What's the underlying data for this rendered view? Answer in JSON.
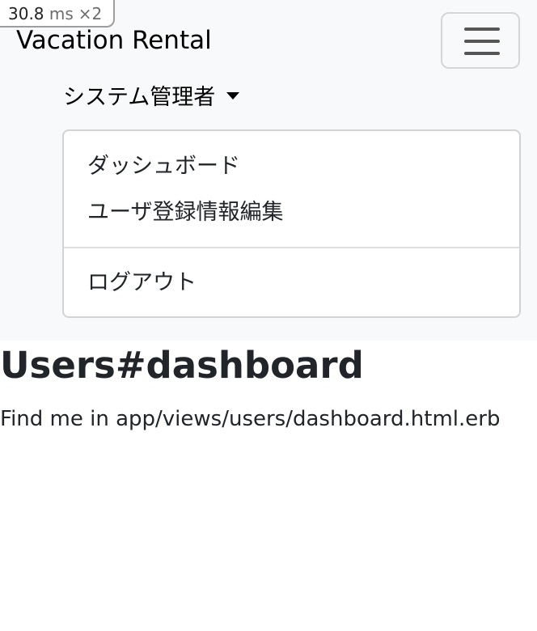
{
  "perf_badge": {
    "value": "30.8",
    "unit": "ms",
    "multiplier": "×2"
  },
  "navbar": {
    "brand": "Vacation Rental",
    "toggler_icon": "hamburger-menu-icon",
    "user_menu": {
      "label": "システム管理者",
      "caret_icon": "caret-down-icon",
      "items": [
        {
          "label": "ダッシュボード"
        },
        {
          "label": "ユーザ登録情報編集"
        },
        {
          "label": "ログアウト"
        }
      ]
    }
  },
  "main": {
    "title": "Users#dashboard",
    "text": "Find me in app/views/users/dashboard.html.erb"
  },
  "colors": {
    "navbar_bg": "#f8f9fa",
    "text": "#212529",
    "border": "#d3d3d3"
  }
}
